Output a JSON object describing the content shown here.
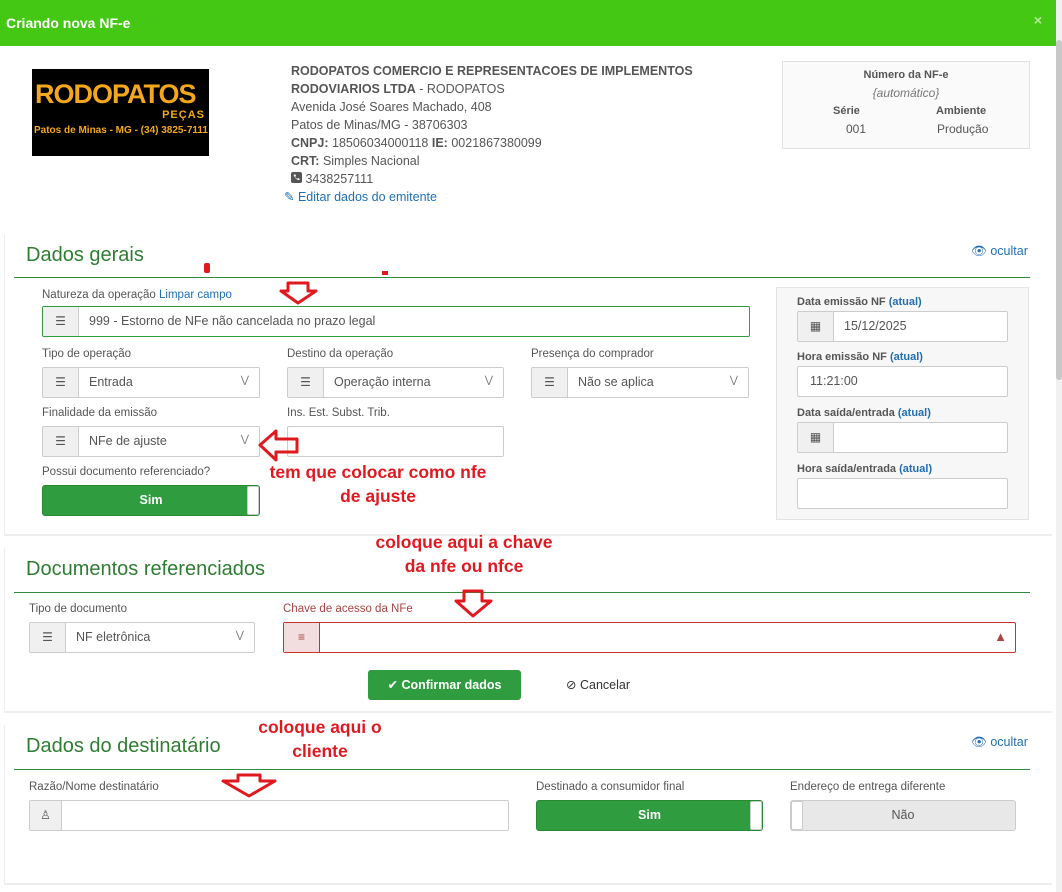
{
  "window": {
    "title": "Criando nova NF-e",
    "close": "×"
  },
  "logo": {
    "brand": "RODOPATOS",
    "pecas": "PEÇAS",
    "sub": "Patos de Minas - MG - (34) 3825-7111"
  },
  "emitter": {
    "name_line1": "RODOPATOS COMERCIO E REPRESENTACOES DE IMPLEMENTOS",
    "name_line2_bold": "RODOVIARIOS LTDA",
    "name_line2_rest": " - RODOPATOS",
    "address": "Avenida José Soares Machado, 408",
    "city": "Patos de Minas/MG - 38706303",
    "cnpj_label": "CNPJ:",
    "cnpj": " 18506034000118 ",
    "ie_label": "IE:",
    "ie": " 0021867380099",
    "crt_label": "CRT:",
    "crt": " Simples Nacional",
    "phone": "3438257111",
    "edit_link": "Editar dados do emitente"
  },
  "nf_box": {
    "title": "Número da NF-e",
    "number": "{automático}",
    "serie_label": "Série",
    "serie": "001",
    "ambiente_label": "Ambiente",
    "ambiente": "Produção"
  },
  "dados_gerais": {
    "title": "Dados gerais",
    "hide": "ocultar",
    "natureza_label": "Natureza da operação",
    "natureza_clear": "Limpar campo",
    "natureza_value": "999 - Estorno de NFe não cancelada no prazo legal",
    "tipo_label": "Tipo de operação",
    "tipo_value": "Entrada",
    "destino_label": "Destino da operação",
    "destino_value": "Operação interna",
    "presenca_label": "Presença do comprador",
    "presenca_value": "Não se aplica",
    "finalidade_label": "Finalidade da emissão",
    "finalidade_value": "NFe de ajuste",
    "ins_label": "Ins. Est. Subst. Trib.",
    "ins_value": "",
    "possui_label": "Possui documento referenciado?",
    "possui_value": "Sim",
    "data_emissao_label": "Data emissão NF",
    "data_emissao_link": "(atual)",
    "data_emissao_value": "15/12/2025",
    "hora_emissao_label": "Hora emissão NF",
    "hora_emissao_link": "(atual)",
    "hora_emissao_value": "11:21:00",
    "data_saida_label": "Data saída/entrada",
    "data_saida_link": "(atual)",
    "hora_saida_label": "Hora saída/entrada",
    "hora_saida_link": "(atual)"
  },
  "documentos": {
    "title": "Documentos referenciados",
    "tipo_label": "Tipo de documento",
    "tipo_value": "NF eletrônica",
    "chave_label": "Chave de acesso da NFe",
    "confirm": "Confirmar dados",
    "cancel": "Cancelar"
  },
  "destinatario": {
    "title": "Dados do destinatário",
    "hide": "ocultar",
    "razao_label": "Razão/Nome destinatário",
    "consumidor_label": "Destinado a consumidor final",
    "consumidor_value": "Sim",
    "endereco_label": "Endereço de entrega diferente",
    "endereco_value": "Não"
  },
  "annotations": {
    "ajuste_1": "tem que colocar como nfe",
    "ajuste_2": "de ajuste",
    "chave_1": "coloque aqui a chave",
    "chave_2": "da nfe ou nfce",
    "cliente_1": "coloque aqui o",
    "cliente_2": "cliente"
  },
  "icons": [
    "close-icon",
    "edit-icon",
    "phone-icon",
    "eye-icon",
    "list-icon",
    "chevron-down-icon",
    "calendar-icon",
    "user-icon",
    "warning-icon",
    "check-icon",
    "cancel-icon",
    "arrow-down-icon",
    "arrow-left-icon"
  ],
  "colors": {
    "header": "#44c814",
    "section": "#2e7d32",
    "button": "#2e9c3f",
    "annotation": "#e0191f",
    "link": "#1f6fb2"
  }
}
